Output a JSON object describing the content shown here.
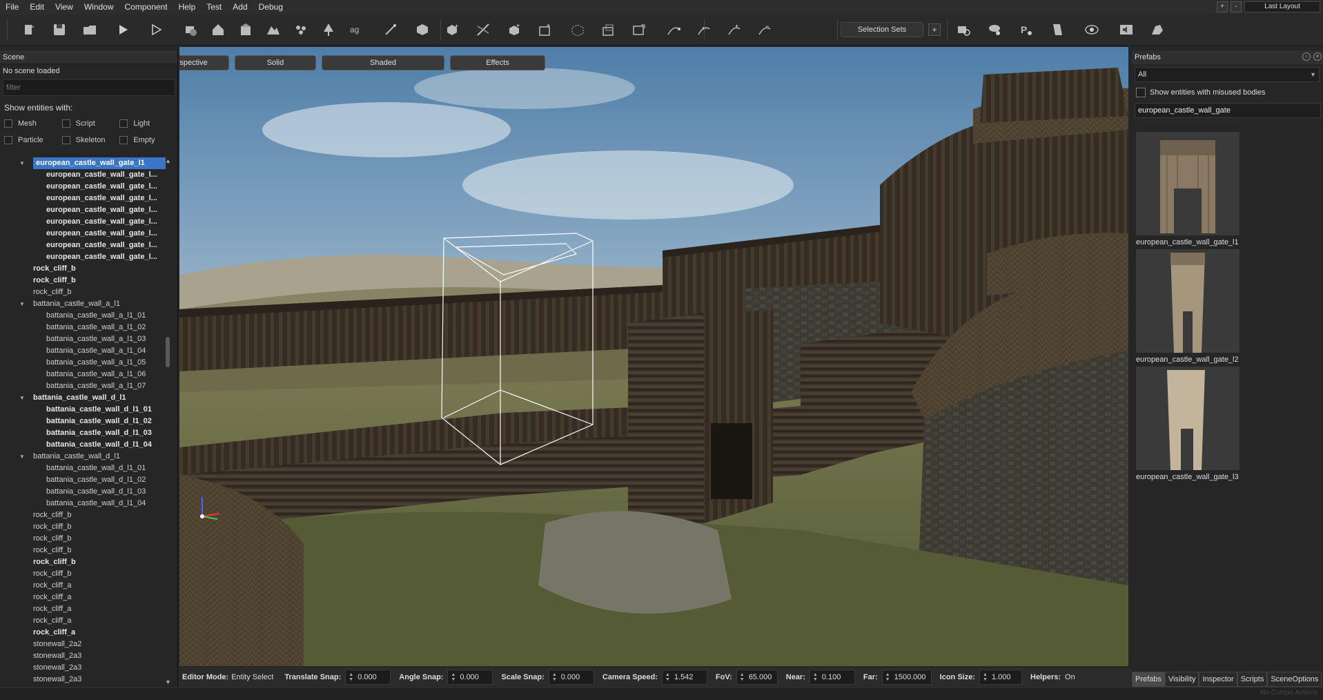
{
  "menu": {
    "items": [
      "File",
      "Edit",
      "View",
      "Window",
      "Component",
      "Help",
      "Test",
      "Add",
      "Debug"
    ]
  },
  "window_controls": {
    "plus": "+",
    "minus": "-",
    "layout": "Last Layout"
  },
  "toolbar": {
    "icons": [
      "new-scene-icon",
      "save-icon",
      "open-folder-icon",
      "play-icon",
      "play-outline-icon",
      "game-icon",
      "house-icon",
      "building-icon",
      "terrain-icon",
      "particles-icon",
      "tree-icon",
      "text-ag-icon",
      "wand-icon",
      "cube-icon",
      "cube-add-icon",
      "cube-cut-icon",
      "cube-plus-icon",
      "mesh-add-icon",
      "mesh-dots-icon",
      "mesh-group-icon",
      "mesh-export-icon",
      "node-edit-icon",
      "node-move-icon",
      "node-add-icon",
      "node-remove-icon"
    ],
    "selection_sets": "Selection Sets",
    "selection_add": "+",
    "right_icons": [
      "camera-search-icon",
      "cloud-settings-icon",
      "physics-icon",
      "paint-icon",
      "eye-settings-icon",
      "sound-icon",
      "sculpt-icon"
    ]
  },
  "scene": {
    "header": "Scene",
    "status": "No scene loaded",
    "filter_placeholder": "filter",
    "show_label": "Show entities with:",
    "checkboxes": [
      [
        "Mesh",
        "Script",
        "Light"
      ],
      [
        "Particle",
        "Skeleton",
        "Empty"
      ]
    ],
    "tree": [
      {
        "text": "european_castle_wall_gate_l1",
        "level": 0,
        "bold": true,
        "expanded": true,
        "selected": true
      },
      {
        "text": "european_castle_wall_gate_l...",
        "level": 1,
        "bold": true
      },
      {
        "text": "european_castle_wall_gate_l...",
        "level": 1,
        "bold": true
      },
      {
        "text": "european_castle_wall_gate_l...",
        "level": 1,
        "bold": true
      },
      {
        "text": "european_castle_wall_gate_l...",
        "level": 1,
        "bold": true
      },
      {
        "text": "european_castle_wall_gate_l...",
        "level": 1,
        "bold": true
      },
      {
        "text": "european_castle_wall_gate_l...",
        "level": 1,
        "bold": true
      },
      {
        "text": "european_castle_wall_gate_l...",
        "level": 1,
        "bold": true
      },
      {
        "text": "european_castle_wall_gate_l...",
        "level": 1,
        "bold": true
      },
      {
        "text": "rock_cliff_b",
        "level": 0,
        "bold": true
      },
      {
        "text": "rock_cliff_b",
        "level": 0,
        "bold": true
      },
      {
        "text": "rock_cliff_b",
        "level": 0,
        "bold": false
      },
      {
        "text": "battania_castle_wall_a_l1",
        "level": 0,
        "bold": false,
        "expanded": true
      },
      {
        "text": "battania_castle_wall_a_l1_01",
        "level": 1,
        "bold": false
      },
      {
        "text": "battania_castle_wall_a_l1_02",
        "level": 1,
        "bold": false
      },
      {
        "text": "battania_castle_wall_a_l1_03",
        "level": 1,
        "bold": false
      },
      {
        "text": "battania_castle_wall_a_l1_04",
        "level": 1,
        "bold": false
      },
      {
        "text": "battania_castle_wall_a_l1_05",
        "level": 1,
        "bold": false
      },
      {
        "text": "battania_castle_wall_a_l1_06",
        "level": 1,
        "bold": false
      },
      {
        "text": "battania_castle_wall_a_l1_07",
        "level": 1,
        "bold": false
      },
      {
        "text": "battania_castle_wall_d_l1",
        "level": 0,
        "bold": true,
        "expanded": true
      },
      {
        "text": "battania_castle_wall_d_l1_01",
        "level": 1,
        "bold": true
      },
      {
        "text": "battania_castle_wall_d_l1_02",
        "level": 1,
        "bold": true
      },
      {
        "text": "battania_castle_wall_d_l1_03",
        "level": 1,
        "bold": true
      },
      {
        "text": "battania_castle_wall_d_l1_04",
        "level": 1,
        "bold": true
      },
      {
        "text": "battania_castle_wall_d_l1",
        "level": 0,
        "bold": false,
        "expanded": true
      },
      {
        "text": "battania_castle_wall_d_l1_01",
        "level": 1,
        "bold": false
      },
      {
        "text": "battania_castle_wall_d_l1_02",
        "level": 1,
        "bold": false
      },
      {
        "text": "battania_castle_wall_d_l1_03",
        "level": 1,
        "bold": false
      },
      {
        "text": "battania_castle_wall_d_l1_04",
        "level": 1,
        "bold": false
      },
      {
        "text": "rock_cliff_b",
        "level": 0,
        "bold": false
      },
      {
        "text": "rock_cliff_b",
        "level": 0,
        "bold": false
      },
      {
        "text": "rock_cliff_b",
        "level": 0,
        "bold": false
      },
      {
        "text": "rock_cliff_b",
        "level": 0,
        "bold": false
      },
      {
        "text": "rock_cliff_b",
        "level": 0,
        "bold": true
      },
      {
        "text": "rock_cliff_b",
        "level": 0,
        "bold": false
      },
      {
        "text": "rock_cliff_a",
        "level": 0,
        "bold": false
      },
      {
        "text": "rock_cliff_a",
        "level": 0,
        "bold": false
      },
      {
        "text": "rock_cliff_a",
        "level": 0,
        "bold": false
      },
      {
        "text": "rock_cliff_a",
        "level": 0,
        "bold": false
      },
      {
        "text": "rock_cliff_a",
        "level": 0,
        "bold": true
      },
      {
        "text": "stonewall_2a2",
        "level": 0,
        "bold": false
      },
      {
        "text": "stonewall_2a3",
        "level": 0,
        "bold": false
      },
      {
        "text": "stonewall_2a3",
        "level": 0,
        "bold": false
      },
      {
        "text": "stonewall_2a3",
        "level": 0,
        "bold": false
      }
    ]
  },
  "viewport": {
    "buttons": [
      "Perspective",
      "Solid",
      "Shaded",
      "Effects"
    ]
  },
  "statusbar": {
    "editor_mode_label": "Editor Mode:",
    "editor_mode_value": "Entity Select",
    "translate_snap_label": "Translate Snap:",
    "translate_snap": "0.000",
    "angle_snap_label": "Angle Snap:",
    "angle_snap": "0.000",
    "scale_snap_label": "Scale Snap:",
    "scale_snap": "0.000",
    "camera_speed_label": "Camera Speed:",
    "camera_speed": "1.542",
    "fov_label": "FoV:",
    "fov": "65.000",
    "near_label": "Near:",
    "near": "0.100",
    "far_label": "Far:",
    "far": "1500.000",
    "icon_size_label": "Icon Size:",
    "icon_size": "1.000",
    "helpers_label": "Helpers:",
    "helpers": "On"
  },
  "prefabs": {
    "header": "Prefabs",
    "filter": "All",
    "misused_label": "Show entities with misused bodies",
    "search": "european_castle_wall_gate",
    "items": [
      "european_castle_wall_gate_l1",
      "european_castle_wall_gate_l2",
      "european_castle_wall_gate_l3"
    ]
  },
  "bottom_tabs": [
    "Prefabs",
    "Visibility",
    "Inspector",
    "Scripts",
    "SceneOptions"
  ],
  "bottom_status": "No Compo Actions",
  "colors": {
    "accent": "#3a76c8",
    "panel": "#262626",
    "toolbar": "#2a2a2a",
    "selection_box": "#ffffff"
  }
}
